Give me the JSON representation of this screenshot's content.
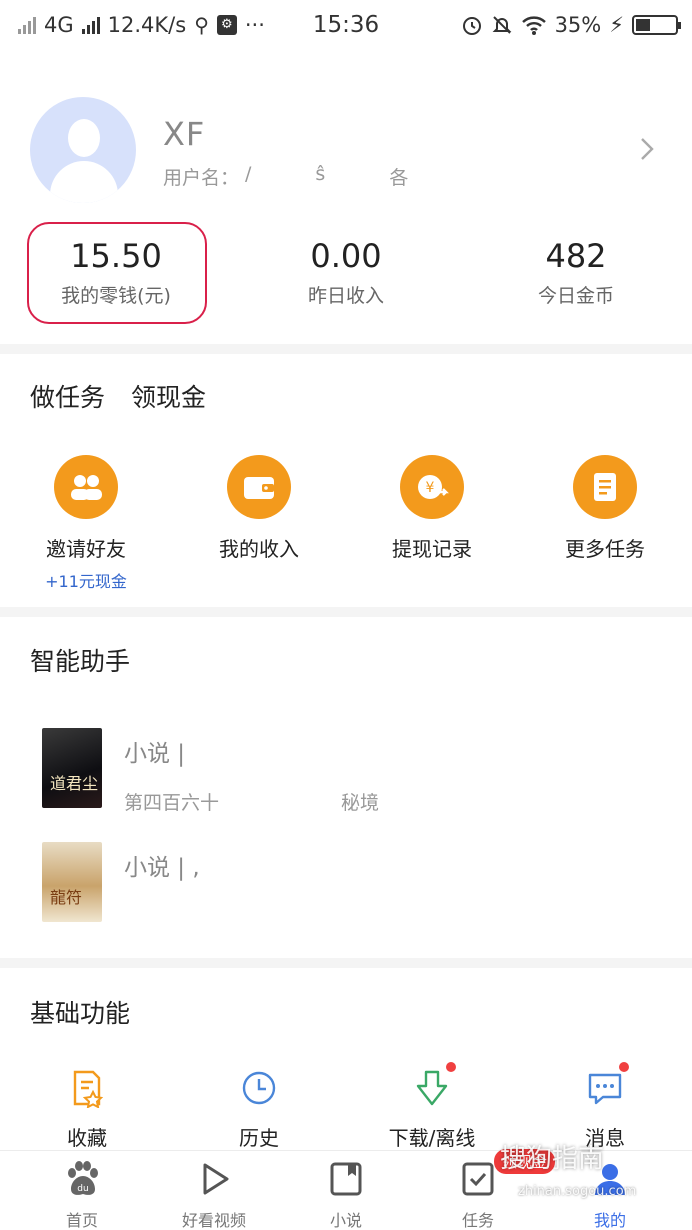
{
  "status_bar": {
    "network": "4G",
    "speed": "12.4K/s",
    "time": "15:36",
    "battery": "35%",
    "more": "···"
  },
  "profile": {
    "name": "XF",
    "username_label": "用户名：",
    "username_frag": [
      "/",
      "ŝ",
      "各"
    ]
  },
  "stats": [
    {
      "value": "15.50",
      "label": "我的零钱(元)"
    },
    {
      "value": "0.00",
      "label": "昨日收入"
    },
    {
      "value": "482",
      "label": "今日金币"
    }
  ],
  "tasks": {
    "title_1": "做任务",
    "title_2": "领现金",
    "items": [
      {
        "label": "邀请好友",
        "sub": "+11元现金",
        "icon": "friends-icon"
      },
      {
        "label": "我的收入",
        "icon": "wallet-icon"
      },
      {
        "label": "提现记录",
        "icon": "yuan-icon"
      },
      {
        "label": "更多任务",
        "icon": "document-icon"
      }
    ]
  },
  "assistant": {
    "title": "智能助手",
    "novels": [
      {
        "title": "小说 |",
        "sub_a": "第四百六十",
        "sub_b": "秘境",
        "cover_text": "道君尘"
      },
      {
        "title": "小说 | ,",
        "cover_text": "龍符"
      }
    ]
  },
  "basic": {
    "title": "基础功能",
    "items": [
      {
        "label": "收藏",
        "icon": "favorite-icon"
      },
      {
        "label": "历史",
        "icon": "clock-icon"
      },
      {
        "label": "下载/离线",
        "icon": "download-icon"
      },
      {
        "label": "消息",
        "icon": "message-icon"
      }
    ]
  },
  "tabbar": {
    "items": [
      {
        "label": "首页",
        "icon": "baidu-paw-icon"
      },
      {
        "label": "好看视频",
        "icon": "play-icon"
      },
      {
        "label": "小说",
        "icon": "book-icon"
      },
      {
        "label": "任务",
        "icon": "task-icon",
        "badge": "领现金"
      },
      {
        "label": "我的",
        "icon": "person-icon"
      }
    ],
    "active_index": 4
  },
  "watermark": {
    "text": "搜狗指南",
    "sub": "zhinan.sogou.com"
  },
  "colors": {
    "accent_orange": "#f39a1c",
    "active_blue": "#3b6ee6",
    "highlight_red": "#d9204a"
  }
}
